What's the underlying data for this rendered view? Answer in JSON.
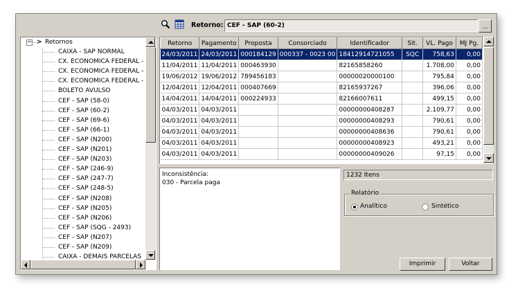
{
  "window": {
    "retorno_label": "Retorno:",
    "retorno_value": "CEF - SAP (60-2)",
    "browse_label": "..."
  },
  "icons": {
    "search": "magnifier-icon",
    "grid": "grid-icon"
  },
  "tree": {
    "root_toggle": "−",
    "root_arrow": ">",
    "root_label": "Retornos",
    "items": [
      "CAIXA - SAP NORMAL",
      "CX. ECONOMICA FEDERAL - F",
      "CX. ECONOMICA FEDERAL - F",
      "CX. ECONOMICA FEDERAL - F",
      "BOLETO AVULSO",
      "CEF - SAP (58-0)",
      "CEF - SAP (60-2)",
      "CEF - SAP (69-6)",
      "CEF - SAP (66-1)",
      "CEF - SAP (N200)",
      "CEF - SAP (N201)",
      "CEF - SAP (N203)",
      "CEF - SAP (246-9)",
      "CEF - SAP (247-7)",
      "CEF - SAP (248-5)",
      "CEF - SAP (N208)",
      "CEF - SAP (N205)",
      "CEF - SAP (N206)",
      "CEF - SAP (SQG - 2493)",
      "CEF - SAP (N207)",
      "CEF - SAP (N209)",
      "CAIXA - DEMAIS PARCELAS"
    ]
  },
  "grid": {
    "headers": [
      "Retorno",
      "Pagamento",
      "Proposta",
      "Consorciado",
      "Identificador",
      "Sit.",
      "VL. Pago",
      "MJ Pg."
    ],
    "rows": [
      [
        "24/03/2011",
        "24/03/2011",
        "000184129",
        "000337 - 0023 00",
        "18412914721055",
        "SQC",
        "758,63",
        "0,00"
      ],
      [
        "11/04/2011",
        "11/04/2011",
        "000463930",
        "",
        "82165858260",
        "",
        "1.708,00",
        "0,00"
      ],
      [
        "19/06/2012",
        "19/06/2012",
        "789456183",
        "",
        "00000020000100",
        "",
        "795,84",
        "0,00"
      ],
      [
        "12/04/2011",
        "12/04/2011",
        "000407669",
        "",
        "82165937267",
        "",
        "396,06",
        "0,00"
      ],
      [
        "14/04/2011",
        "14/04/2011",
        "000224933",
        "",
        "82166007611",
        "",
        "499,15",
        "0,00"
      ],
      [
        "04/03/2011",
        "04/03/2011",
        "",
        "",
        "00000000408287",
        "",
        "2.109,77",
        "0,00"
      ],
      [
        "04/03/2011",
        "04/03/2011",
        "",
        "",
        "00000000408293",
        "",
        "790,61",
        "0,00"
      ],
      [
        "04/03/2011",
        "04/03/2011",
        "",
        "",
        "00000000408636",
        "",
        "790,61",
        "0,00"
      ],
      [
        "04/03/2011",
        "04/03/2011",
        "",
        "",
        "00000000408923",
        "",
        "493,21",
        "0,00"
      ],
      [
        "04/03/2011",
        "04/03/2011",
        "",
        "",
        "00000000409026",
        "",
        "97,15",
        "0,00"
      ]
    ]
  },
  "message": {
    "title": "Inconsistência:",
    "text": "030 - Parcela paga"
  },
  "count_label": "1232 Itens",
  "relatorio": {
    "title": "Relatório",
    "options": [
      "Analítico",
      "Sintético"
    ],
    "selected": "Analítico"
  },
  "buttons": {
    "print": "Imprimir",
    "back": "Voltar"
  }
}
